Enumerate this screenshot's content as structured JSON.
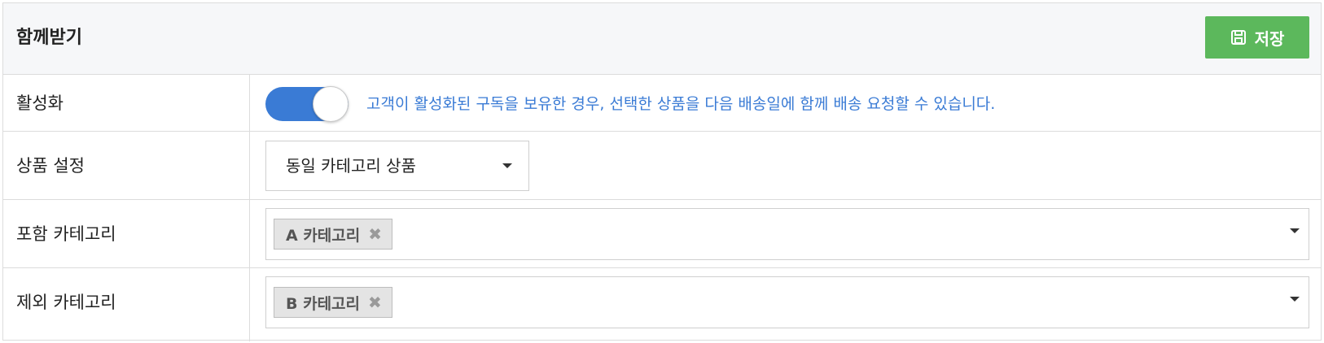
{
  "header": {
    "title": "함께받기",
    "save_label": "저장"
  },
  "rows": {
    "activation": {
      "label": "활성화",
      "toggle_on": true,
      "description": "고객이 활성화된 구독을 보유한 경우, 선택한 상품을 다음 배송일에 함께 배송 요청할 수 있습니다."
    },
    "product_setting": {
      "label": "상품 설정",
      "selected": "동일 카테고리 상품"
    },
    "include_category": {
      "label": "포함 카테고리",
      "tags": [
        "A 카테고리"
      ]
    },
    "exclude_category": {
      "label": "제외 카테고리",
      "tags": [
        "B 카테고리"
      ]
    }
  },
  "colors": {
    "accent_blue": "#3a7bd5",
    "save_green": "#5cb85c"
  },
  "icons": {
    "save": "floppy-disk-icon",
    "dropdown": "chevron-down-icon",
    "tag_remove": "close-icon"
  }
}
